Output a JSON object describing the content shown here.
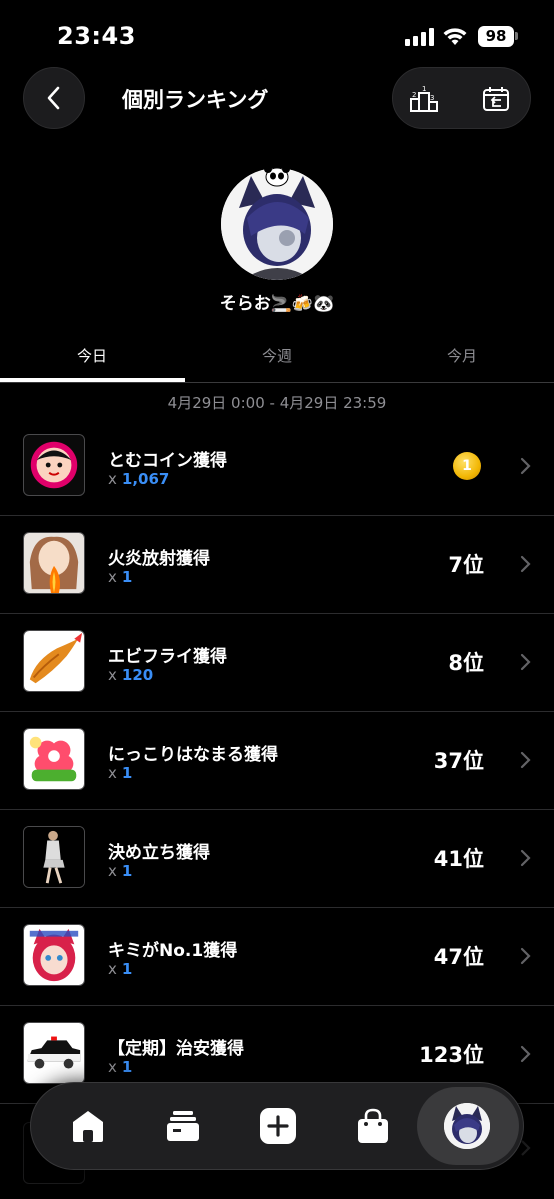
{
  "status_bar": {
    "time": "23:43",
    "battery": "98"
  },
  "header": {
    "title": "個別ランキング"
  },
  "profile": {
    "name": "そらお🚬🍻🐼"
  },
  "tabs": [
    {
      "label": "今日",
      "active": true
    },
    {
      "label": "今週",
      "active": false
    },
    {
      "label": "今月",
      "active": false
    }
  ],
  "period": "4月29日 0:00 - 4月29日 23:59",
  "items": [
    {
      "name": "とむコイン獲得",
      "count": "1,067",
      "rank": "1",
      "medal": true,
      "icon": "coin-face-icon"
    },
    {
      "name": "火炎放射獲得",
      "count": "1",
      "rank": "7位",
      "icon": "flame-girl-icon"
    },
    {
      "name": "エビフライ獲得",
      "count": "120",
      "rank": "8位",
      "icon": "fried-shrimp-icon"
    },
    {
      "name": "にっこりはなまる獲得",
      "count": "1",
      "rank": "37位",
      "icon": "hanamaru-icon"
    },
    {
      "name": "決め立ち獲得",
      "count": "1",
      "rank": "41位",
      "icon": "standing-figure-icon"
    },
    {
      "name": "キミがNo.1獲得",
      "count": "1",
      "rank": "47位",
      "icon": "catgirl-sticker-icon"
    },
    {
      "name": "【定期】治安獲得",
      "count": "1",
      "rank": "123位",
      "icon": "police-car-icon"
    }
  ],
  "colors": {
    "background": "#000000",
    "accent_blue": "#3a8ef6",
    "muted": "#8e8e93",
    "gold": "#f2b705"
  },
  "tabbar": [
    "home-icon",
    "cards-icon",
    "plus-icon",
    "shopping-bag-icon",
    "profile-avatar"
  ]
}
